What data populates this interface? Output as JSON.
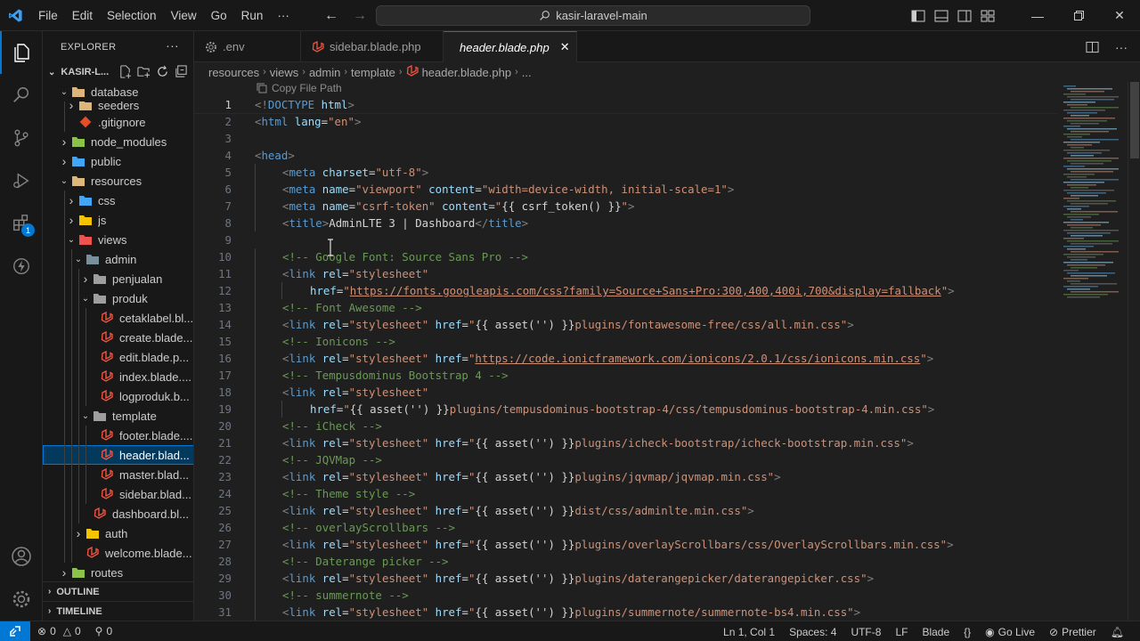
{
  "menu": [
    "File",
    "Edit",
    "Selection",
    "View",
    "Go",
    "Run",
    "···"
  ],
  "search": {
    "text": "kasir-laravel-main"
  },
  "sidebar": {
    "title": "EXPLORER",
    "project": "KASIR-L...",
    "tree": [
      {
        "label": "database",
        "depth": 1,
        "type": "folder-open",
        "color": "#dcb67a"
      },
      {
        "label": "seeders",
        "depth": 2,
        "type": "folder",
        "color": "#dcb67a"
      },
      {
        "label": ".gitignore",
        "depth": 2,
        "type": "git",
        "color": "#e44d26"
      },
      {
        "label": "node_modules",
        "depth": 1,
        "type": "folder",
        "color": "#8bc34a"
      },
      {
        "label": "public",
        "depth": 1,
        "type": "folder",
        "color": "#42a5f5"
      },
      {
        "label": "resources",
        "depth": 1,
        "type": "folder-open",
        "color": "#dcb67a"
      },
      {
        "label": "css",
        "depth": 2,
        "type": "folder",
        "color": "#42a5f5"
      },
      {
        "label": "js",
        "depth": 2,
        "type": "folder",
        "color": "#f5c400"
      },
      {
        "label": "views",
        "depth": 2,
        "type": "folder-open",
        "color": "#ef5350"
      },
      {
        "label": "admin",
        "depth": 3,
        "type": "folder-open",
        "color": "#78909c"
      },
      {
        "label": "penjualan",
        "depth": 4,
        "type": "folder",
        "color": "#9e9e9e"
      },
      {
        "label": "produk",
        "depth": 4,
        "type": "folder-open",
        "color": "#9e9e9e"
      },
      {
        "label": "cetaklabel.bl...",
        "depth": 5,
        "type": "blade",
        "color": "#f05340"
      },
      {
        "label": "create.blade...",
        "depth": 5,
        "type": "blade",
        "color": "#f05340"
      },
      {
        "label": "edit.blade.p...",
        "depth": 5,
        "type": "blade",
        "color": "#f05340"
      },
      {
        "label": "index.blade....",
        "depth": 5,
        "type": "blade",
        "color": "#f05340"
      },
      {
        "label": "logproduk.b...",
        "depth": 5,
        "type": "blade",
        "color": "#f05340"
      },
      {
        "label": "template",
        "depth": 4,
        "type": "folder-open",
        "color": "#9e9e9e"
      },
      {
        "label": "footer.blade....",
        "depth": 5,
        "type": "blade",
        "color": "#f05340"
      },
      {
        "label": "header.blad...",
        "depth": 5,
        "type": "blade",
        "color": "#f05340",
        "selected": true
      },
      {
        "label": "master.blad...",
        "depth": 5,
        "type": "blade",
        "color": "#f05340"
      },
      {
        "label": "sidebar.blad...",
        "depth": 5,
        "type": "blade",
        "color": "#f05340"
      },
      {
        "label": "dashboard.bl...",
        "depth": 4,
        "type": "blade",
        "color": "#f05340"
      },
      {
        "label": "auth",
        "depth": 3,
        "type": "folder",
        "color": "#f5c400"
      },
      {
        "label": "welcome.blade...",
        "depth": 3,
        "type": "blade",
        "color": "#f05340"
      },
      {
        "label": "routes",
        "depth": 1,
        "type": "folder",
        "color": "#8bc34a"
      }
    ],
    "outline": "OUTLINE",
    "timeline": "TIMELINE"
  },
  "tabs": [
    {
      "label": ".env",
      "icon": "gear-icon",
      "active": false
    },
    {
      "label": "sidebar.blade.php",
      "icon": "laravel-icon",
      "active": false
    },
    {
      "label": "header.blade.php",
      "icon": "laravel-icon",
      "active": true
    }
  ],
  "breadcrumbs": [
    "resources",
    "views",
    "admin",
    "template",
    "header.blade.php",
    "..."
  ],
  "tooltip": "Copy File Path",
  "editor": {
    "current_line": 1,
    "lines": [
      {
        "n": 1,
        "i": 0,
        "t": [
          [
            "tag",
            "<!"
          ],
          [
            "name",
            "DOCTYPE"
          ],
          [
            "txt",
            " "
          ],
          [
            "attr",
            "html"
          ],
          [
            "tag",
            ">"
          ]
        ]
      },
      {
        "n": 2,
        "i": 0,
        "t": [
          [
            "tag",
            "<"
          ],
          [
            "name",
            "html"
          ],
          [
            "txt",
            " "
          ],
          [
            "attr",
            "lang"
          ],
          [
            "txt",
            "="
          ],
          [
            "str",
            "\"en\""
          ],
          [
            "tag",
            ">"
          ]
        ]
      },
      {
        "n": 3,
        "i": 0,
        "t": []
      },
      {
        "n": 4,
        "i": 0,
        "t": [
          [
            "tag",
            "<"
          ],
          [
            "name",
            "head"
          ],
          [
            "tag",
            ">"
          ]
        ]
      },
      {
        "n": 5,
        "i": 1,
        "t": [
          [
            "tag",
            "<"
          ],
          [
            "name",
            "meta"
          ],
          [
            "txt",
            " "
          ],
          [
            "attr",
            "charset"
          ],
          [
            "txt",
            "="
          ],
          [
            "str",
            "\"utf-8\""
          ],
          [
            "tag",
            ">"
          ]
        ]
      },
      {
        "n": 6,
        "i": 1,
        "t": [
          [
            "tag",
            "<"
          ],
          [
            "name",
            "meta"
          ],
          [
            "txt",
            " "
          ],
          [
            "attr",
            "name"
          ],
          [
            "txt",
            "="
          ],
          [
            "str",
            "\"viewport\""
          ],
          [
            "txt",
            " "
          ],
          [
            "attr",
            "content"
          ],
          [
            "txt",
            "="
          ],
          [
            "str",
            "\"width=device-width, initial-scale=1\""
          ],
          [
            "tag",
            ">"
          ]
        ]
      },
      {
        "n": 7,
        "i": 1,
        "t": [
          [
            "tag",
            "<"
          ],
          [
            "name",
            "meta"
          ],
          [
            "txt",
            " "
          ],
          [
            "attr",
            "name"
          ],
          [
            "txt",
            "="
          ],
          [
            "str",
            "\"csrf-token\""
          ],
          [
            "txt",
            " "
          ],
          [
            "attr",
            "content"
          ],
          [
            "txt",
            "="
          ],
          [
            "str",
            "\""
          ],
          [
            "txt",
            "{{ csrf_token() }}"
          ],
          [
            "str",
            "\""
          ],
          [
            "tag",
            ">"
          ]
        ]
      },
      {
        "n": 8,
        "i": 1,
        "t": [
          [
            "tag",
            "<"
          ],
          [
            "name",
            "title"
          ],
          [
            "tag",
            ">"
          ],
          [
            "txt",
            "AdminLTE 3 | Dashboard"
          ],
          [
            "tag",
            "</"
          ],
          [
            "name",
            "title"
          ],
          [
            "tag",
            ">"
          ]
        ]
      },
      {
        "n": 9,
        "i": 0,
        "t": []
      },
      {
        "n": 10,
        "i": 1,
        "t": [
          [
            "com",
            "<!-- Google Font: Source Sans Pro -->"
          ]
        ]
      },
      {
        "n": 11,
        "i": 1,
        "t": [
          [
            "tag",
            "<"
          ],
          [
            "name",
            "link"
          ],
          [
            "txt",
            " "
          ],
          [
            "attr",
            "rel"
          ],
          [
            "txt",
            "="
          ],
          [
            "str",
            "\"stylesheet\""
          ]
        ]
      },
      {
        "n": 12,
        "i": 2,
        "t": [
          [
            "attr",
            "href"
          ],
          [
            "txt",
            "="
          ],
          [
            "str",
            "\""
          ],
          [
            "url",
            "https://fonts.googleapis.com/css?family=Source+Sans+Pro:300,400,400i,700&display=fallback"
          ],
          [
            "str",
            "\""
          ],
          [
            "tag",
            ">"
          ]
        ]
      },
      {
        "n": 13,
        "i": 1,
        "t": [
          [
            "com",
            "<!-- Font Awesome -->"
          ]
        ]
      },
      {
        "n": 14,
        "i": 1,
        "t": [
          [
            "tag",
            "<"
          ],
          [
            "name",
            "link"
          ],
          [
            "txt",
            " "
          ],
          [
            "attr",
            "rel"
          ],
          [
            "txt",
            "="
          ],
          [
            "str",
            "\"stylesheet\""
          ],
          [
            "txt",
            " "
          ],
          [
            "attr",
            "href"
          ],
          [
            "txt",
            "="
          ],
          [
            "str",
            "\""
          ],
          [
            "txt",
            "{{ asset('') }}"
          ],
          [
            "str",
            "plugins/fontawesome-free/css/all.min.css\""
          ],
          [
            "tag",
            ">"
          ]
        ]
      },
      {
        "n": 15,
        "i": 1,
        "t": [
          [
            "com",
            "<!-- Ionicons -->"
          ]
        ]
      },
      {
        "n": 16,
        "i": 1,
        "t": [
          [
            "tag",
            "<"
          ],
          [
            "name",
            "link"
          ],
          [
            "txt",
            " "
          ],
          [
            "attr",
            "rel"
          ],
          [
            "txt",
            "="
          ],
          [
            "str",
            "\"stylesheet\""
          ],
          [
            "txt",
            " "
          ],
          [
            "attr",
            "href"
          ],
          [
            "txt",
            "="
          ],
          [
            "str",
            "\""
          ],
          [
            "url",
            "https://code.ionicframework.com/ionicons/2.0.1/css/ionicons.min.css"
          ],
          [
            "str",
            "\""
          ],
          [
            "tag",
            ">"
          ]
        ]
      },
      {
        "n": 17,
        "i": 1,
        "t": [
          [
            "com",
            "<!-- Tempusdominus Bootstrap 4 -->"
          ]
        ]
      },
      {
        "n": 18,
        "i": 1,
        "t": [
          [
            "tag",
            "<"
          ],
          [
            "name",
            "link"
          ],
          [
            "txt",
            " "
          ],
          [
            "attr",
            "rel"
          ],
          [
            "txt",
            "="
          ],
          [
            "str",
            "\"stylesheet\""
          ]
        ]
      },
      {
        "n": 19,
        "i": 2,
        "t": [
          [
            "attr",
            "href"
          ],
          [
            "txt",
            "="
          ],
          [
            "str",
            "\""
          ],
          [
            "txt",
            "{{ asset('') }}"
          ],
          [
            "str",
            "plugins/tempusdominus-bootstrap-4/css/tempusdominus-bootstrap-4.min.css\""
          ],
          [
            "tag",
            ">"
          ]
        ]
      },
      {
        "n": 20,
        "i": 1,
        "t": [
          [
            "com",
            "<!-- iCheck -->"
          ]
        ]
      },
      {
        "n": 21,
        "i": 1,
        "t": [
          [
            "tag",
            "<"
          ],
          [
            "name",
            "link"
          ],
          [
            "txt",
            " "
          ],
          [
            "attr",
            "rel"
          ],
          [
            "txt",
            "="
          ],
          [
            "str",
            "\"stylesheet\""
          ],
          [
            "txt",
            " "
          ],
          [
            "attr",
            "href"
          ],
          [
            "txt",
            "="
          ],
          [
            "str",
            "\""
          ],
          [
            "txt",
            "{{ asset('') }}"
          ],
          [
            "str",
            "plugins/icheck-bootstrap/icheck-bootstrap.min.css\""
          ],
          [
            "tag",
            ">"
          ]
        ]
      },
      {
        "n": 22,
        "i": 1,
        "t": [
          [
            "com",
            "<!-- JQVMap -->"
          ]
        ]
      },
      {
        "n": 23,
        "i": 1,
        "t": [
          [
            "tag",
            "<"
          ],
          [
            "name",
            "link"
          ],
          [
            "txt",
            " "
          ],
          [
            "attr",
            "rel"
          ],
          [
            "txt",
            "="
          ],
          [
            "str",
            "\"stylesheet\""
          ],
          [
            "txt",
            " "
          ],
          [
            "attr",
            "href"
          ],
          [
            "txt",
            "="
          ],
          [
            "str",
            "\""
          ],
          [
            "txt",
            "{{ asset('') }}"
          ],
          [
            "str",
            "plugins/jqvmap/jqvmap.min.css\""
          ],
          [
            "tag",
            ">"
          ]
        ]
      },
      {
        "n": 24,
        "i": 1,
        "t": [
          [
            "com",
            "<!-- Theme style -->"
          ]
        ]
      },
      {
        "n": 25,
        "i": 1,
        "t": [
          [
            "tag",
            "<"
          ],
          [
            "name",
            "link"
          ],
          [
            "txt",
            " "
          ],
          [
            "attr",
            "rel"
          ],
          [
            "txt",
            "="
          ],
          [
            "str",
            "\"stylesheet\""
          ],
          [
            "txt",
            " "
          ],
          [
            "attr",
            "href"
          ],
          [
            "txt",
            "="
          ],
          [
            "str",
            "\""
          ],
          [
            "txt",
            "{{ asset('') }}"
          ],
          [
            "str",
            "dist/css/adminlte.min.css\""
          ],
          [
            "tag",
            ">"
          ]
        ]
      },
      {
        "n": 26,
        "i": 1,
        "t": [
          [
            "com",
            "<!-- overlayScrollbars -->"
          ]
        ]
      },
      {
        "n": 27,
        "i": 1,
        "t": [
          [
            "tag",
            "<"
          ],
          [
            "name",
            "link"
          ],
          [
            "txt",
            " "
          ],
          [
            "attr",
            "rel"
          ],
          [
            "txt",
            "="
          ],
          [
            "str",
            "\"stylesheet\""
          ],
          [
            "txt",
            " "
          ],
          [
            "attr",
            "href"
          ],
          [
            "txt",
            "="
          ],
          [
            "str",
            "\""
          ],
          [
            "txt",
            "{{ asset('') }}"
          ],
          [
            "str",
            "plugins/overlayScrollbars/css/OverlayScrollbars.min.css\""
          ],
          [
            "tag",
            ">"
          ]
        ]
      },
      {
        "n": 28,
        "i": 1,
        "t": [
          [
            "com",
            "<!-- Daterange picker -->"
          ]
        ]
      },
      {
        "n": 29,
        "i": 1,
        "t": [
          [
            "tag",
            "<"
          ],
          [
            "name",
            "link"
          ],
          [
            "txt",
            " "
          ],
          [
            "attr",
            "rel"
          ],
          [
            "txt",
            "="
          ],
          [
            "str",
            "\"stylesheet\""
          ],
          [
            "txt",
            " "
          ],
          [
            "attr",
            "href"
          ],
          [
            "txt",
            "="
          ],
          [
            "str",
            "\""
          ],
          [
            "txt",
            "{{ asset('') }}"
          ],
          [
            "str",
            "plugins/daterangepicker/daterangepicker.css\""
          ],
          [
            "tag",
            ">"
          ]
        ]
      },
      {
        "n": 30,
        "i": 1,
        "t": [
          [
            "com",
            "<!-- summernote -->"
          ]
        ]
      },
      {
        "n": 31,
        "i": 1,
        "t": [
          [
            "tag",
            "<"
          ],
          [
            "name",
            "link"
          ],
          [
            "txt",
            " "
          ],
          [
            "attr",
            "rel"
          ],
          [
            "txt",
            "="
          ],
          [
            "str",
            "\"stylesheet\""
          ],
          [
            "txt",
            " "
          ],
          [
            "attr",
            "href"
          ],
          [
            "txt",
            "="
          ],
          [
            "str",
            "\""
          ],
          [
            "txt",
            "{{ asset('') }}"
          ],
          [
            "str",
            "plugins/summernote/summernote-bs4.min.css\""
          ],
          [
            "tag",
            ">"
          ]
        ]
      }
    ]
  },
  "status": {
    "errors": "0",
    "warnings": "0",
    "ports": "0",
    "position": "Ln 1, Col 1",
    "spaces": "Spaces: 4",
    "encoding": "UTF-8",
    "eol": "LF",
    "language": "Blade",
    "golive": "Go Live",
    "prettier": "Prettier"
  },
  "colors": {
    "accent": "#0078d4",
    "laravel": "#f05340"
  }
}
